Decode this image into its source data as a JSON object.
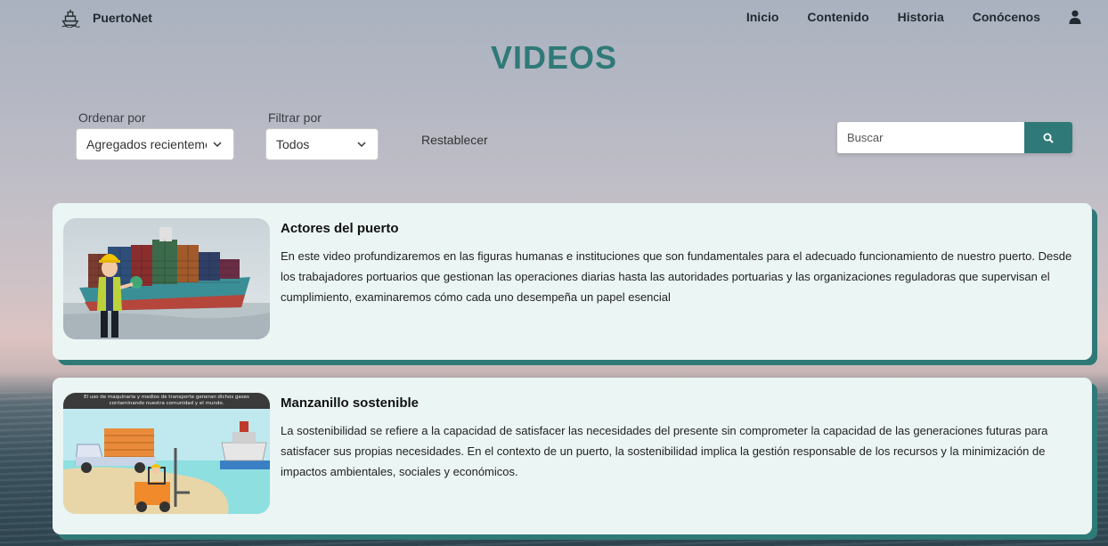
{
  "nav": {
    "brand": "PuertoNet",
    "brand_icon": "ship-icon",
    "links": [
      "Inicio",
      "Contenido",
      "Historia",
      "Conócenos"
    ],
    "user_icon": "user-icon"
  },
  "page": {
    "title": "VIDEOS"
  },
  "filters": {
    "sort_label": "Ordenar por",
    "sort_value": "Agregados recientemente",
    "filter_label": "Filtrar por",
    "filter_value": "Todos",
    "reset": "Restablecer",
    "search_placeholder": "Buscar",
    "search_icon": "search-icon"
  },
  "videos": [
    {
      "title": "Actores del puerto",
      "description": "En este video profundizaremos en las figuras humanas e instituciones que son fundamentales para el adecuado funcionamiento de nuestro puerto. Desde los trabajadores portuarios que gestionan las operaciones diarias hasta las autoridades portuarias y las organizaciones reguladoras que supervisan el cumplimiento, examinaremos cómo cada uno desempeña un papel esencial"
    },
    {
      "title": "Manzanillo sostenible",
      "description": "La sostenibilidad se refiere a la capacidad de satisfacer las necesidades del presente sin comprometer la capacidad de las generaciones futuras para satisfacer sus propias necesidades. En el contexto de un puerto, la sostenibilidad implica la gestión responsable de los recursos y la minimización de impactos ambientales, sociales y económicos.",
      "thumb_caption": "El uso de maquinaria y medios de transporte generan dichos gases contaminando nuestra comunidad y el mundo."
    }
  ],
  "colors": {
    "accent": "#2f7a78",
    "card_bg": "#ebf5f3"
  }
}
